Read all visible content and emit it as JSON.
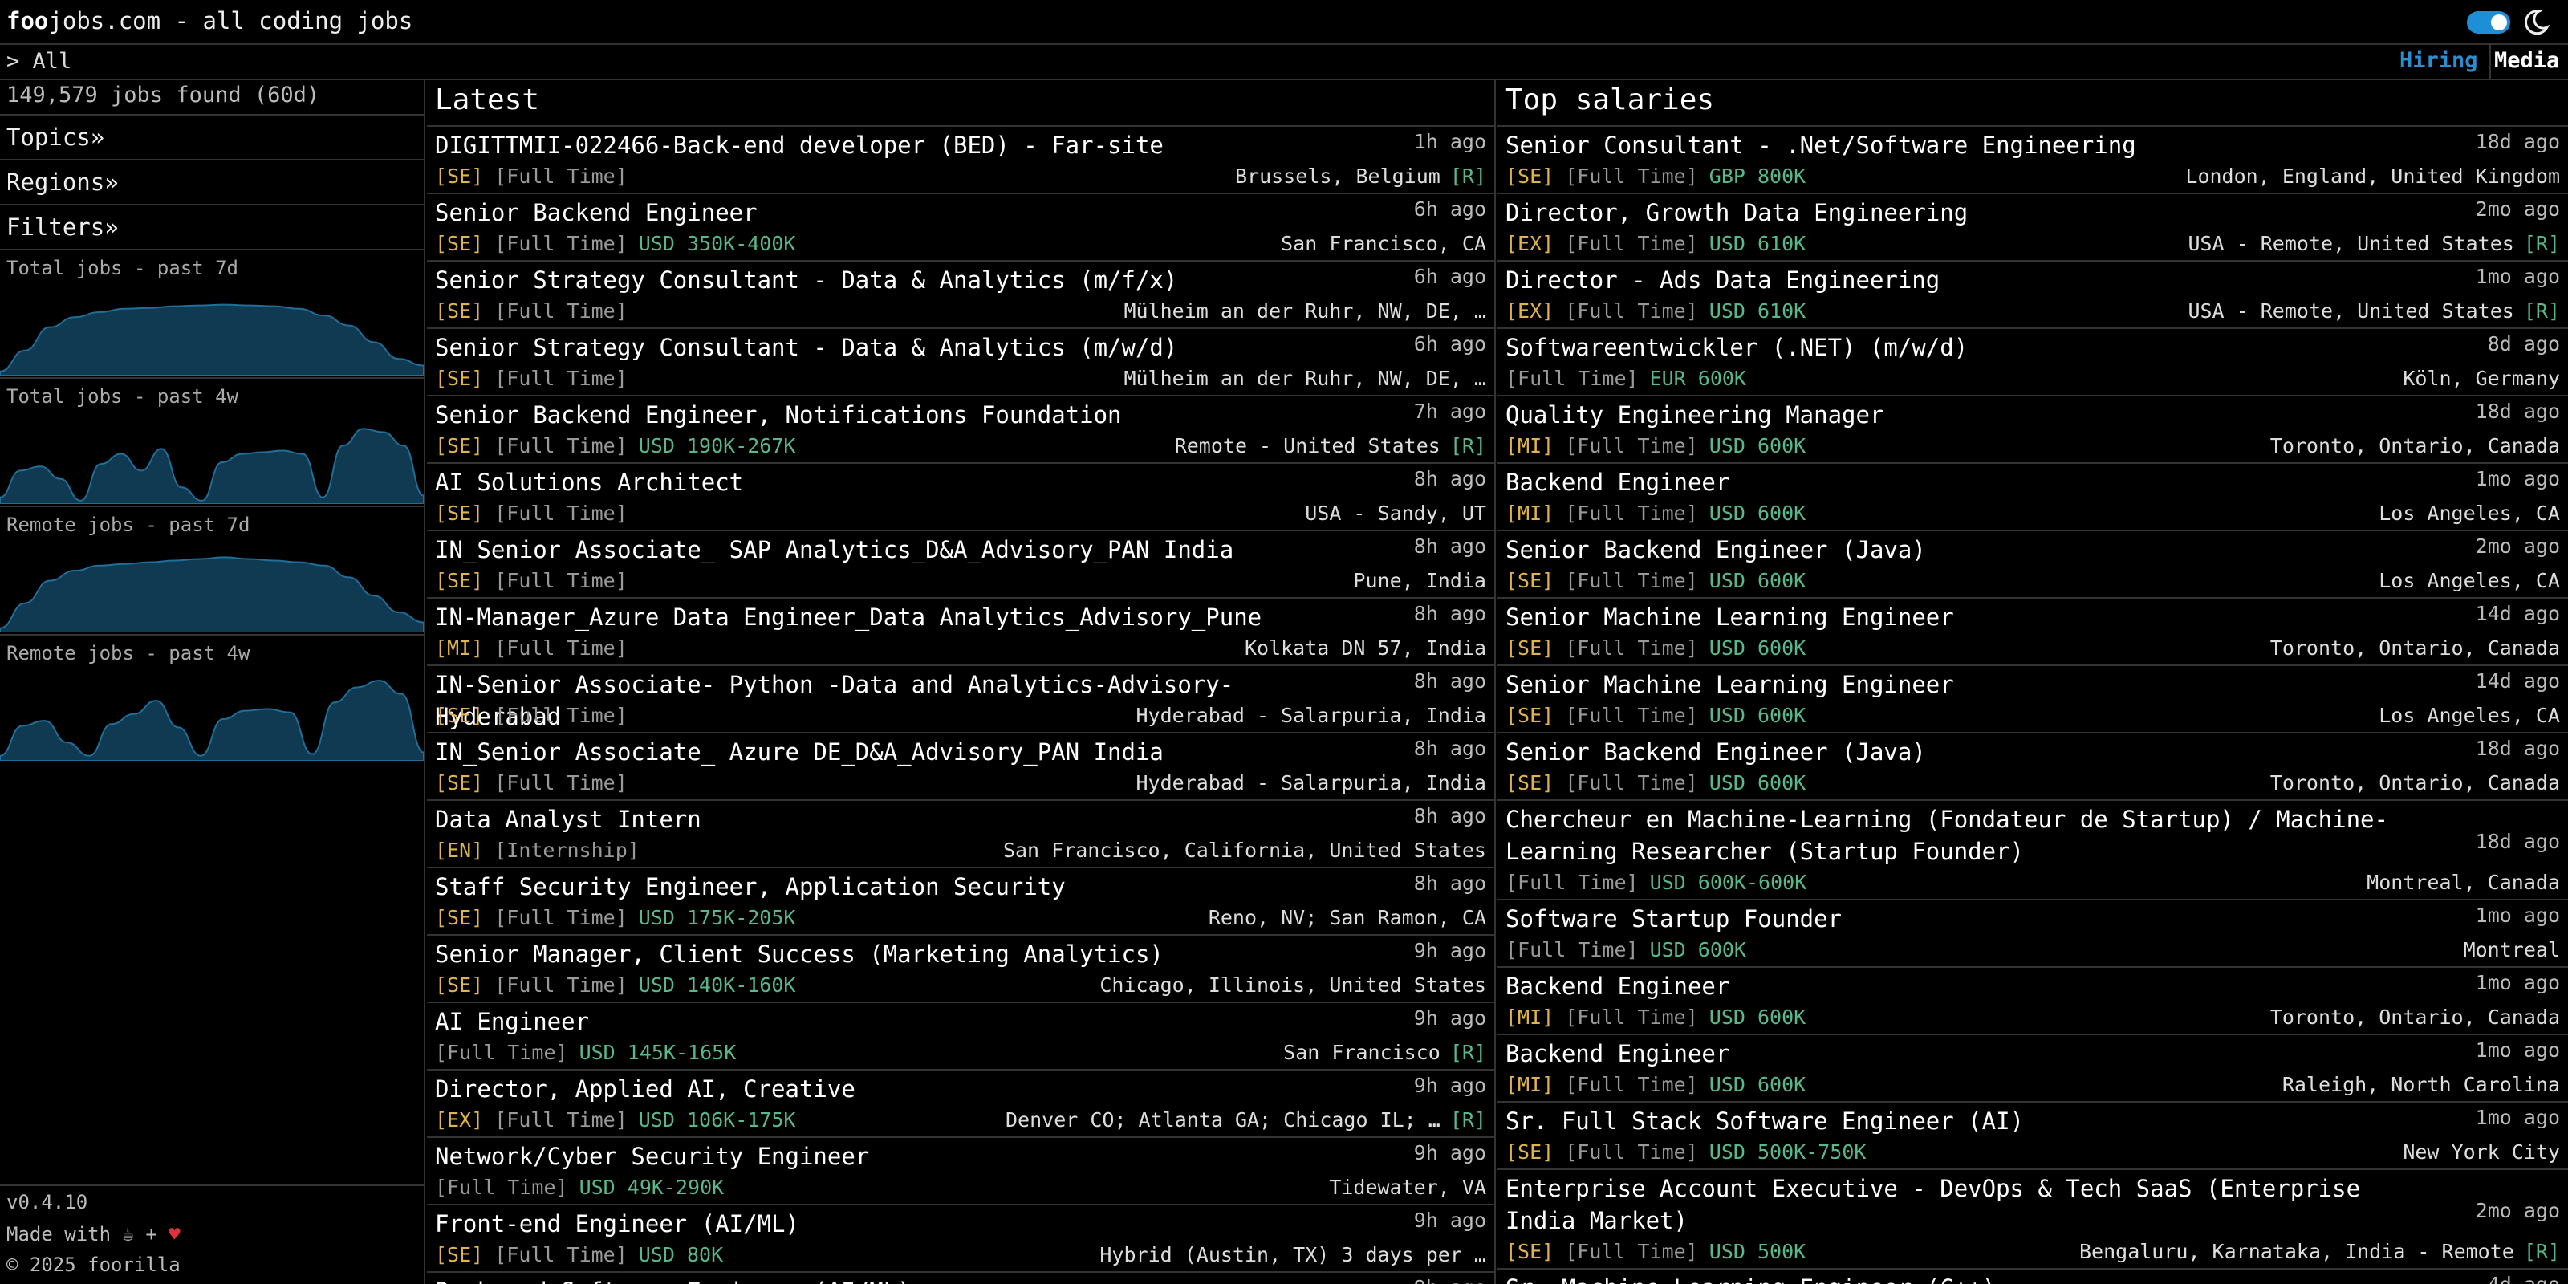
{
  "app": {
    "logo_bold": "foo",
    "logo_rest": "jobs.com - all coding jobs"
  },
  "crumb": "> All",
  "nav": {
    "hiring": "Hiring",
    "media": "Media"
  },
  "sidebar": {
    "count": "149,579 jobs found (60d)",
    "topics": "Topics»",
    "regions": "Regions»",
    "filters": "Filters»",
    "graphs": [
      {
        "label": "Total jobs - past 7d",
        "values": [
          5,
          30,
          58,
          70,
          76,
          80,
          81,
          83,
          84,
          85,
          84,
          83,
          80,
          72,
          60,
          40,
          20,
          12
        ]
      },
      {
        "label": "Total jobs - past 4w",
        "values": [
          8,
          40,
          45,
          30,
          4,
          48,
          60,
          40,
          66,
          20,
          4,
          50,
          60,
          62,
          64,
          60,
          8,
          70,
          90,
          86,
          70,
          10
        ]
      },
      {
        "label": "Remote jobs - past 7d",
        "values": [
          5,
          35,
          62,
          74,
          80,
          82,
          84,
          86,
          88,
          90,
          88,
          86,
          84,
          80,
          66,
          44,
          24,
          12
        ]
      },
      {
        "label": "Remote jobs - past 4w",
        "values": [
          6,
          42,
          48,
          22,
          6,
          44,
          56,
          72,
          40,
          6,
          50,
          60,
          62,
          58,
          8,
          70,
          88,
          96,
          80,
          10
        ]
      }
    ],
    "version": "v0.4.10",
    "made_with": "Made with ☕ + ",
    "heart": "♥",
    "copyright": "© 2025 foorilla"
  },
  "colors": {
    "accent": "#1e8fd6",
    "graph_fill": "#0f3a52",
    "graph_line": "#1f6f99",
    "level": "#e0b34c",
    "salary": "#57b88a"
  },
  "latest": {
    "title": "Latest",
    "jobs": [
      {
        "title": "DIGITTMII-022466-Back-end developer (BED) - Far-site",
        "ago": "1h ago",
        "level": "[SE]",
        "type": "[Full Time]",
        "salary": "",
        "location": "Brussels, Belgium",
        "remote": "[R]"
      },
      {
        "title": "Senior Backend Engineer",
        "ago": "6h ago",
        "level": "[SE]",
        "type": "[Full Time]",
        "salary": "USD 350K-400K",
        "location": "San Francisco, CA",
        "remote": ""
      },
      {
        "title": "Senior Strategy Consultant - Data & Analytics (m/f/x)",
        "ago": "6h ago",
        "level": "[SE]",
        "type": "[Full Time]",
        "salary": "",
        "location": "Mülheim an der Ruhr, NW, DE, …",
        "remote": ""
      },
      {
        "title": "Senior Strategy Consultant - Data & Analytics (m/w/d)",
        "ago": "6h ago",
        "level": "[SE]",
        "type": "[Full Time]",
        "salary": "",
        "location": "Mülheim an der Ruhr, NW, DE, …",
        "remote": ""
      },
      {
        "title": "Senior Backend Engineer, Notifications Foundation",
        "ago": "7h ago",
        "level": "[SE]",
        "type": "[Full Time]",
        "salary": "USD 190K-267K",
        "location": "Remote - United States",
        "remote": "[R]"
      },
      {
        "title": "AI Solutions Architect",
        "ago": "8h ago",
        "level": "[SE]",
        "type": "[Full Time]",
        "salary": "",
        "location": "USA - Sandy, UT",
        "remote": ""
      },
      {
        "title": "IN_Senior Associate_ SAP Analytics_D&A_Advisory_PAN India",
        "ago": "8h ago",
        "level": "[SE]",
        "type": "[Full Time]",
        "salary": "",
        "location": "Pune, India",
        "remote": ""
      },
      {
        "title": "IN-Manager_Azure Data Engineer_Data Analytics_Advisory_Pune",
        "ago": "8h ago",
        "level": "[MI]",
        "type": "[Full Time]",
        "salary": "",
        "location": "Kolkata DN 57, India",
        "remote": ""
      },
      {
        "title": "IN-Senior Associate- Python -Data and Analytics-Advisory-Hyderabad",
        "ago": "8h ago",
        "level": "[SE]",
        "type": "[Full Time]",
        "salary": "",
        "location": "Hyderabad - Salarpuria, India",
        "remote": ""
      },
      {
        "title": "IN_Senior Associate_ Azure DE_D&A_Advisory_PAN India",
        "ago": "8h ago",
        "level": "[SE]",
        "type": "[Full Time]",
        "salary": "",
        "location": "Hyderabad - Salarpuria, India",
        "remote": ""
      },
      {
        "title": "Data Analyst Intern",
        "ago": "8h ago",
        "level": "[EN]",
        "type": "[Internship]",
        "salary": "",
        "location": "San Francisco, California, United States",
        "remote": ""
      },
      {
        "title": "Staff Security Engineer, Application Security",
        "ago": "8h ago",
        "level": "[SE]",
        "type": "[Full Time]",
        "salary": "USD 175K-205K",
        "location": "Reno, NV; San Ramon, CA",
        "remote": ""
      },
      {
        "title": "Senior Manager, Client Success (Marketing Analytics)",
        "ago": "9h ago",
        "level": "[SE]",
        "type": "[Full Time]",
        "salary": "USD 140K-160K",
        "location": "Chicago, Illinois, United States",
        "remote": ""
      },
      {
        "title": "AI Engineer",
        "ago": "9h ago",
        "level": "",
        "type": "[Full Time]",
        "salary": "USD 145K-165K",
        "location": "San Francisco",
        "remote": "[R]"
      },
      {
        "title": "Director, Applied AI, Creative",
        "ago": "9h ago",
        "level": "[EX]",
        "type": "[Full Time]",
        "salary": "USD 106K-175K",
        "location": "Denver CO; Atlanta GA; Chicago IL; …",
        "remote": "[R]"
      },
      {
        "title": "Network/Cyber Security Engineer",
        "ago": "9h ago",
        "level": "",
        "type": "[Full Time]",
        "salary": "USD 49K-290K",
        "location": "Tidewater, VA",
        "remote": ""
      },
      {
        "title": "Front-end Engineer (AI/ML)",
        "ago": "9h ago",
        "level": "[SE]",
        "type": "[Full Time]",
        "salary": "USD 80K",
        "location": "Hybrid (Austin, TX) 3 days per …",
        "remote": ""
      },
      {
        "title": "Back-end Software Engineer (AI/ML)",
        "ago": "9h ago",
        "level": "",
        "type": "",
        "salary": "",
        "location": "",
        "remote": ""
      }
    ]
  },
  "top": {
    "title": "Top salaries",
    "jobs": [
      {
        "title": "Senior Consultant - .Net/Software Engineering",
        "ago": "18d ago",
        "level": "[SE]",
        "type": "[Full Time]",
        "salary": "GBP 800K",
        "location": "London, England, United Kingdom",
        "remote": ""
      },
      {
        "title": "Director, Growth Data Engineering",
        "ago": "2mo ago",
        "level": "[EX]",
        "type": "[Full Time]",
        "salary": "USD 610K",
        "location": "USA - Remote, United States",
        "remote": "[R]"
      },
      {
        "title": "Director - Ads Data Engineering",
        "ago": "1mo ago",
        "level": "[EX]",
        "type": "[Full Time]",
        "salary": "USD 610K",
        "location": "USA - Remote, United States",
        "remote": "[R]"
      },
      {
        "title": "Softwareentwickler (.NET) (m/w/d)",
        "ago": "8d ago",
        "level": "",
        "type": "[Full Time]",
        "salary": "EUR 600K",
        "location": "Köln, Germany",
        "remote": ""
      },
      {
        "title": "Quality Engineering Manager",
        "ago": "18d ago",
        "level": "[MI]",
        "type": "[Full Time]",
        "salary": "USD 600K",
        "location": "Toronto, Ontario, Canada",
        "remote": ""
      },
      {
        "title": "Backend Engineer",
        "ago": "1mo ago",
        "level": "[MI]",
        "type": "[Full Time]",
        "salary": "USD 600K",
        "location": "Los Angeles, CA",
        "remote": ""
      },
      {
        "title": "Senior Backend Engineer (Java)",
        "ago": "2mo ago",
        "level": "[SE]",
        "type": "[Full Time]",
        "salary": "USD 600K",
        "location": "Los Angeles, CA",
        "remote": ""
      },
      {
        "title": "Senior Machine Learning Engineer",
        "ago": "14d ago",
        "level": "[SE]",
        "type": "[Full Time]",
        "salary": "USD 600K",
        "location": "Toronto, Ontario, Canada",
        "remote": ""
      },
      {
        "title": "Senior Machine Learning Engineer",
        "ago": "14d ago",
        "level": "[SE]",
        "type": "[Full Time]",
        "salary": "USD 600K",
        "location": "Los Angeles, CA",
        "remote": ""
      },
      {
        "title": "Senior Backend Engineer (Java)",
        "ago": "18d ago",
        "level": "[SE]",
        "type": "[Full Time]",
        "salary": "USD 600K",
        "location": "Toronto, Ontario, Canada",
        "remote": ""
      },
      {
        "title": "Chercheur en Machine-Learning (Fondateur de Startup) / Machine-Learning Researcher (Startup Founder)",
        "ago": "18d ago",
        "level": "",
        "type": "[Full Time]",
        "salary": "USD 600K-600K",
        "location": "Montreal, Canada",
        "remote": "",
        "tall": true
      },
      {
        "title": "Software Startup Founder",
        "ago": "1mo ago",
        "level": "",
        "type": "[Full Time]",
        "salary": "USD 600K",
        "location": "Montreal",
        "remote": ""
      },
      {
        "title": "Backend Engineer",
        "ago": "1mo ago",
        "level": "[MI]",
        "type": "[Full Time]",
        "salary": "USD 600K",
        "location": "Toronto, Ontario, Canada",
        "remote": ""
      },
      {
        "title": "Backend Engineer",
        "ago": "1mo ago",
        "level": "[MI]",
        "type": "[Full Time]",
        "salary": "USD 600K",
        "location": "Raleigh, North Carolina",
        "remote": ""
      },
      {
        "title": "Sr. Full Stack Software Engineer (AI)",
        "ago": "1mo ago",
        "level": "[SE]",
        "type": "[Full Time]",
        "salary": "USD 500K-750K",
        "location": "New York City",
        "remote": ""
      },
      {
        "title": "Enterprise Account Executive - DevOps & Tech SaaS (Enterprise India Market)",
        "ago": "2mo ago",
        "level": "[SE]",
        "type": "[Full Time]",
        "salary": "USD 500K",
        "location": "Bengaluru, Karnataka, India - Remote",
        "remote": "[R]",
        "tall": true
      },
      {
        "title": "Sr. Machine Learning Engineer (C++)",
        "ago": "4d ago",
        "level": "",
        "type": "",
        "salary": "",
        "location": "",
        "remote": ""
      }
    ]
  }
}
